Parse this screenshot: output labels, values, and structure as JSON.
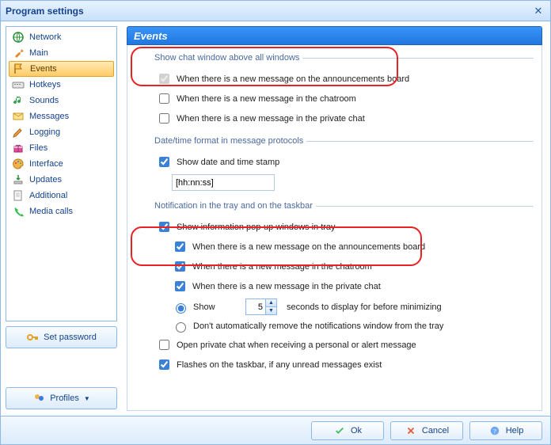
{
  "window": {
    "title": "Program settings"
  },
  "sidebar": {
    "items": [
      {
        "label": "Network",
        "icon": "globe",
        "selected": false
      },
      {
        "label": "Main",
        "icon": "wrench",
        "selected": false
      },
      {
        "label": "Events",
        "icon": "flag",
        "selected": true
      },
      {
        "label": "Hotkeys",
        "icon": "keyboard",
        "selected": false
      },
      {
        "label": "Sounds",
        "icon": "music",
        "selected": false
      },
      {
        "label": "Messages",
        "icon": "envelope",
        "selected": false
      },
      {
        "label": "Logging",
        "icon": "pencil",
        "selected": false
      },
      {
        "label": "Files",
        "icon": "gift",
        "selected": false
      },
      {
        "label": "Interface",
        "icon": "palette",
        "selected": false
      },
      {
        "label": "Updates",
        "icon": "updates",
        "selected": false
      },
      {
        "label": "Additional",
        "icon": "page",
        "selected": false
      },
      {
        "label": "Media calls",
        "icon": "phone",
        "selected": false
      }
    ],
    "set_password": "Set password",
    "profiles": "Profiles"
  },
  "pane": {
    "title": "Events",
    "group1": {
      "legend": "Show chat window above all windows",
      "ann_board": "When there is a new message on the announcements board",
      "chatroom": "When there is a new message in the chatroom",
      "private": "When there is a new message in the private chat",
      "ann_board_checked": true,
      "chatroom_checked": false,
      "private_checked": false
    },
    "group2": {
      "legend": "Date/time format in message protocols",
      "show_stamp": "Show date and time stamp",
      "show_stamp_checked": true,
      "format_value": "[hh:nn:ss]"
    },
    "group3": {
      "legend": "Notification in the tray and on the taskbar",
      "popup": "Show information pop-up windows in tray",
      "popup_checked": true,
      "ann_board": "When there is a new message on the announcements board",
      "ann_board_checked": true,
      "chatroom": "When there is a new message in the chatroom",
      "chatroom_checked": true,
      "private": "When there is a new message in the private chat",
      "private_checked": true,
      "show_radio": "Show",
      "seconds_value": "5",
      "seconds_suffix": "seconds to display for before minimizing",
      "dont_remove": "Don't automatically remove the notifications window from the tray",
      "radio_selected": "show",
      "open_private": "Open private chat when receiving a personal or alert message",
      "open_private_checked": false,
      "flashes": "Flashes on the taskbar, if any unread messages exist",
      "flashes_checked": true
    }
  },
  "footer": {
    "ok": "Ok",
    "cancel": "Cancel",
    "help": "Help"
  }
}
